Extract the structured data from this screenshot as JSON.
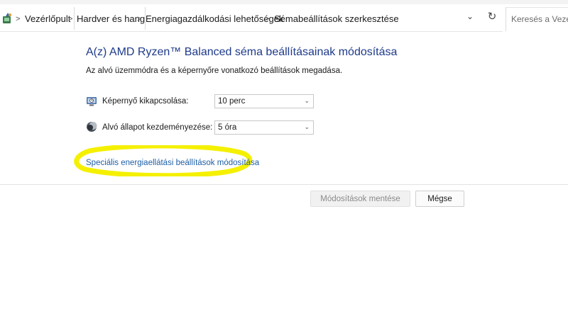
{
  "breadcrumb": {
    "items": [
      {
        "label": "Vezérlőpult"
      },
      {
        "label": "Hardver és hang"
      },
      {
        "label": "Energiagazdálkodási lehetőségek"
      },
      {
        "label": "Sémabeállítások szerkesztése"
      }
    ]
  },
  "search": {
    "placeholder": "Keresés a Vezérlőpulton"
  },
  "page": {
    "title": "A(z) AMD Ryzen™ Balanced séma beállításainak módosítása",
    "subtitle": "Az alvó üzemmódra és a képernyőre vonatkozó beállítások megadása."
  },
  "settings": [
    {
      "label": "Képernyő kikapcsolása:",
      "value": "10 perc",
      "icon": "monitor-icon"
    },
    {
      "label": "Alvó állapot kezdeményezése:",
      "value": "5 óra",
      "icon": "moon-icon"
    }
  ],
  "advanced_link": "Speciális energiaellátási beállítások módosítása",
  "buttons": {
    "save": "Módosítások mentése",
    "cancel": "Mégse"
  },
  "colors": {
    "title": "#1e3a8a",
    "link": "#1f5fa6",
    "highlight": "#f5f000"
  }
}
